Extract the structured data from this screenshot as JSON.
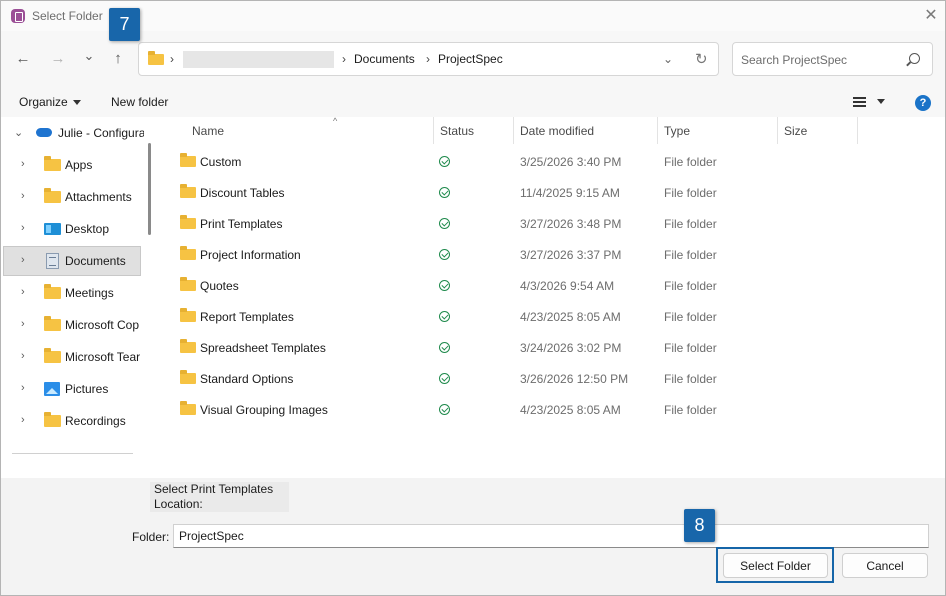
{
  "window": {
    "title": "Select Folder",
    "close_glyph": "✕"
  },
  "nav": {
    "back_glyph": "←",
    "forward_glyph": "→",
    "recent_glyph": "⌄",
    "up_glyph": "↑"
  },
  "address": {
    "separator": "›",
    "crumbs": [
      "Documents",
      "ProjectSpec"
    ],
    "dropdown_glyph": "⌄",
    "refresh_glyph": "↻"
  },
  "search": {
    "placeholder": "Search ProjectSpec"
  },
  "commands": {
    "organize": "Organize",
    "new_folder": "New folder",
    "help": "?"
  },
  "tree": {
    "root": {
      "label": "Julie - Configura",
      "chevron": "⌄"
    },
    "chevron": "›",
    "items": [
      {
        "label": "Apps",
        "icon": "folder-icon"
      },
      {
        "label": "Attachments",
        "icon": "folder-icon"
      },
      {
        "label": "Desktop",
        "icon": "desktop-icon"
      },
      {
        "label": "Documents",
        "icon": "documents-icon",
        "selected": true
      },
      {
        "label": "Meetings",
        "icon": "folder-icon"
      },
      {
        "label": "Microsoft Cop",
        "icon": "folder-icon"
      },
      {
        "label": "Microsoft Tear",
        "icon": "folder-icon"
      },
      {
        "label": "Pictures",
        "icon": "pictures-icon"
      },
      {
        "label": "Recordings",
        "icon": "folder-icon"
      }
    ]
  },
  "columns": {
    "name": "Name",
    "status": "Status",
    "date": "Date modified",
    "type": "Type",
    "size": "Size",
    "sort_glyph": "^"
  },
  "files": [
    {
      "name": "Custom",
      "date": "3/25/2026 3:40 PM",
      "type": "File folder"
    },
    {
      "name": "Discount Tables",
      "date": "11/4/2025 9:15 AM",
      "type": "File folder"
    },
    {
      "name": "Print Templates",
      "date": "3/27/2026 3:48 PM",
      "type": "File folder"
    },
    {
      "name": "Project Information",
      "date": "3/27/2026 3:37 PM",
      "type": "File folder"
    },
    {
      "name": "Quotes",
      "date": "4/3/2026 9:54 AM",
      "type": "File folder"
    },
    {
      "name": "Report Templates",
      "date": "4/23/2025 8:05 AM",
      "type": "File folder"
    },
    {
      "name": "Spreadsheet Templates",
      "date": "3/24/2026 3:02 PM",
      "type": "File folder"
    },
    {
      "name": "Standard Options",
      "date": "3/26/2026 12:50 PM",
      "type": "File folder"
    },
    {
      "name": "Visual Grouping Images",
      "date": "4/23/2025 8:05 AM",
      "type": "File folder"
    }
  ],
  "description": {
    "line1": "Select Print Templates",
    "line2": "Location:"
  },
  "folder_field": {
    "label": "Folder:",
    "value": "ProjectSpec"
  },
  "buttons": {
    "select": "Select Folder",
    "cancel": "Cancel"
  },
  "badges": {
    "step7": "7",
    "step8": "8"
  },
  "colors": {
    "badge": "#1866aa",
    "folder": "#f6c343",
    "status_ok": "#1f8a4c",
    "help": "#1a73c8"
  }
}
